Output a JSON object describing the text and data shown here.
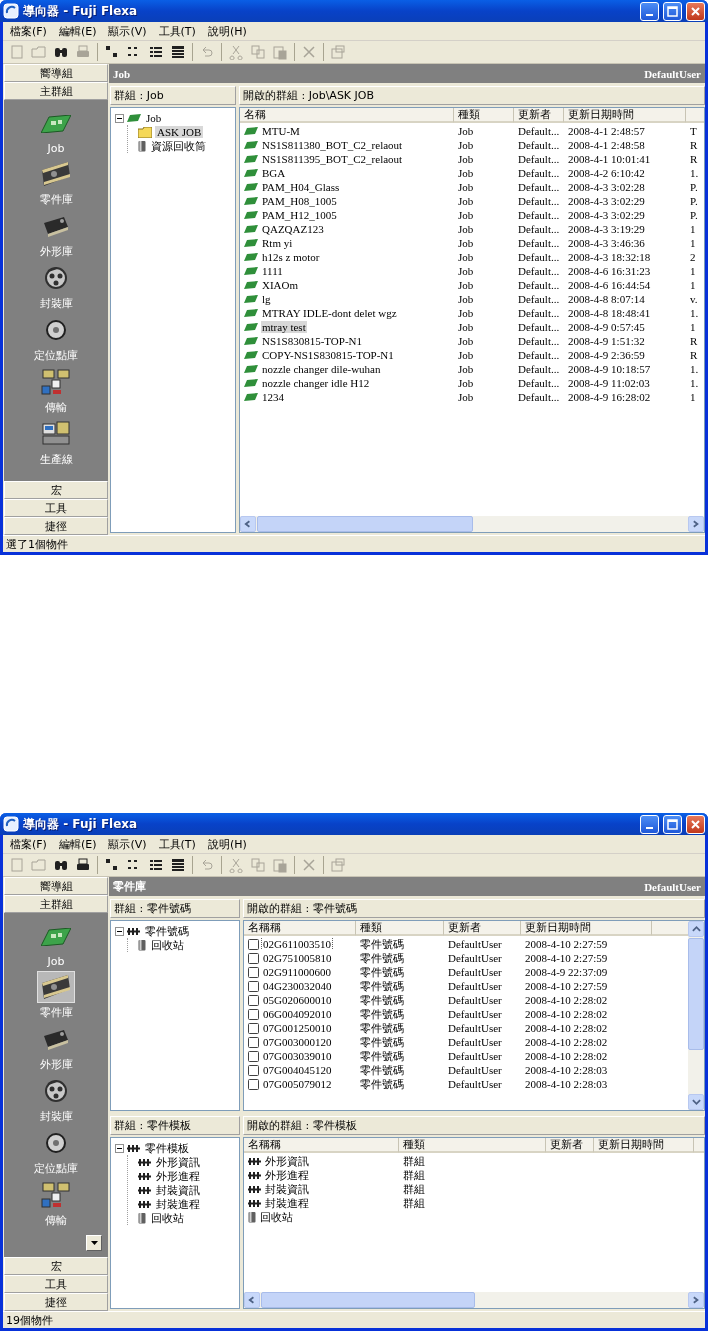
{
  "windows": [
    {
      "title": "導向器 - Fuji Flexa",
      "menu": [
        "檔案(F)",
        "編輯(E)",
        "顯示(V)",
        "工具(T)",
        "說明(H)"
      ],
      "toolbar": [
        {
          "kind": "new",
          "disabled": true
        },
        {
          "kind": "open",
          "disabled": true
        },
        {
          "kind": "find",
          "disabled": false
        },
        {
          "kind": "print",
          "disabled": true
        },
        {
          "kind": "separator"
        },
        {
          "kind": "large-icons",
          "disabled": false
        },
        {
          "kind": "small-icons",
          "disabled": false
        },
        {
          "kind": "list",
          "disabled": false
        },
        {
          "kind": "details",
          "disabled": false
        },
        {
          "kind": "separator"
        },
        {
          "kind": "undo",
          "disabled": true
        },
        {
          "kind": "separator"
        },
        {
          "kind": "cut",
          "disabled": true
        },
        {
          "kind": "copy",
          "disabled": true
        },
        {
          "kind": "paste",
          "disabled": true
        },
        {
          "kind": "separator"
        },
        {
          "kind": "delete",
          "disabled": true
        },
        {
          "kind": "separator"
        },
        {
          "kind": "properties",
          "disabled": true
        }
      ],
      "sidebar": {
        "top_tabs": [
          "嚮導組",
          "主群組"
        ],
        "items": [
          {
            "label": "Job",
            "kind": "job",
            "selected": false
          },
          {
            "label": "零件庫",
            "kind": "part",
            "selected": false
          },
          {
            "label": "外形庫",
            "kind": "shape",
            "selected": false
          },
          {
            "label": "封裝庫",
            "kind": "package",
            "selected": false
          },
          {
            "label": "定位點庫",
            "kind": "fiducial",
            "selected": false
          },
          {
            "label": "傳輸",
            "kind": "transfer",
            "selected": false
          },
          {
            "label": "生產線",
            "kind": "line",
            "selected": false
          }
        ],
        "bottom_tabs": [
          "宏",
          "工具",
          "捷徑"
        ]
      },
      "header": {
        "title": "Job",
        "user": "DefaultUser"
      },
      "panes": [
        {
          "tree": {
            "title": "群組 : Job",
            "nodes": [
              {
                "label": "Job",
                "kind": "job",
                "expanded": true,
                "selected": false,
                "children": [
                  {
                    "label": "ASK JOB",
                    "kind": "folder",
                    "selected": true
                  },
                  {
                    "label": "資源回收筒",
                    "kind": "recycle",
                    "selected": false
                  }
                ]
              }
            ]
          },
          "list": {
            "title": "開啟的群組 : Job\\ASK JOB",
            "columns": [
              "名稱",
              "種類",
              "更新者",
              "更新日期時間"
            ],
            "rows": [
              {
                "kind": "job",
                "selected": false,
                "cells": [
                  "MTU-M",
                  "Job",
                  "Default...",
                  "2008-4-1 2:48:57",
                  "T"
                ]
              },
              {
                "kind": "job",
                "selected": false,
                "cells": [
                  "NS1S811380_BOT_C2_relaout",
                  "Job",
                  "Default...",
                  "2008-4-1 2:48:58",
                  "R"
                ]
              },
              {
                "kind": "job",
                "selected": false,
                "cells": [
                  "NS1S811395_BOT_C2_relaout",
                  "Job",
                  "Default...",
                  "2008-4-1 10:01:41",
                  "R"
                ]
              },
              {
                "kind": "job",
                "selected": false,
                "cells": [
                  "BGA",
                  "Job",
                  "Default...",
                  "2008-4-2 6:10:42",
                  "1."
                ]
              },
              {
                "kind": "job",
                "selected": false,
                "cells": [
                  "PAM_H04_Glass",
                  "Job",
                  "Default...",
                  "2008-4-3 3:02:28",
                  "P."
                ]
              },
              {
                "kind": "job",
                "selected": false,
                "cells": [
                  "PAM_H08_1005",
                  "Job",
                  "Default...",
                  "2008-4-3 3:02:29",
                  "P."
                ]
              },
              {
                "kind": "job",
                "selected": false,
                "cells": [
                  "PAM_H12_1005",
                  "Job",
                  "Default...",
                  "2008-4-3 3:02:29",
                  "P."
                ]
              },
              {
                "kind": "job",
                "selected": false,
                "cells": [
                  "QAZQAZ123",
                  "Job",
                  "Default...",
                  "2008-4-3 3:19:29",
                  "1"
                ]
              },
              {
                "kind": "job",
                "selected": false,
                "cells": [
                  "Rtm yi",
                  "Job",
                  "Default...",
                  "2008-4-3 3:46:36",
                  "1"
                ]
              },
              {
                "kind": "job",
                "selected": false,
                "cells": [
                  "h12s z motor",
                  "Job",
                  "Default...",
                  "2008-4-3 18:32:18",
                  "2"
                ]
              },
              {
                "kind": "job",
                "selected": false,
                "cells": [
                  "1111",
                  "Job",
                  "Default...",
                  "2008-4-6 16:31:23",
                  "1"
                ]
              },
              {
                "kind": "job",
                "selected": false,
                "cells": [
                  "XIAOm",
                  "Job",
                  "Default...",
                  "2008-4-6 16:44:54",
                  "1"
                ]
              },
              {
                "kind": "job",
                "selected": false,
                "cells": [
                  "lg",
                  "Job",
                  "Default...",
                  "2008-4-8 8:07:14",
                  "v."
                ]
              },
              {
                "kind": "job",
                "selected": false,
                "cells": [
                  "MTRAY IDLE-dont delet  wgz",
                  "Job",
                  "Default...",
                  "2008-4-8 18:48:41",
                  "1."
                ]
              },
              {
                "kind": "job",
                "selected": true,
                "cells": [
                  "mtray test",
                  "Job",
                  "Default...",
                  "2008-4-9 0:57:45",
                  "1"
                ]
              },
              {
                "kind": "job",
                "selected": false,
                "cells": [
                  "NS1S830815-TOP-N1",
                  "Job",
                  "Default...",
                  "2008-4-9 1:51:32",
                  "R"
                ]
              },
              {
                "kind": "job",
                "selected": false,
                "cells": [
                  "COPY-NS1S830815-TOP-N1",
                  "Job",
                  "Default...",
                  "2008-4-9 2:36:59",
                  "R"
                ]
              },
              {
                "kind": "job",
                "selected": false,
                "cells": [
                  "nozzle changer dile-wuhan",
                  "Job",
                  "Default...",
                  "2008-4-9 10:18:57",
                  "1."
                ]
              },
              {
                "kind": "job",
                "selected": false,
                "cells": [
                  "nozzle changer idle H12",
                  "Job",
                  "Default...",
                  "2008-4-9 11:02:03",
                  "1."
                ]
              },
              {
                "kind": "job",
                "selected": false,
                "cells": [
                  "1234",
                  "Job",
                  "Default...",
                  "2008-4-9 16:28:02",
                  "1"
                ]
              }
            ]
          }
        }
      ],
      "status": "選了1個物件"
    },
    {
      "title": "導向器 - Fuji Flexa",
      "menu": [
        "檔案(F)",
        "編輯(E)",
        "顯示(V)",
        "工具(T)",
        "說明(H)"
      ],
      "toolbar": [
        {
          "kind": "new",
          "disabled": true
        },
        {
          "kind": "open",
          "disabled": true
        },
        {
          "kind": "find",
          "disabled": false
        },
        {
          "kind": "print",
          "disabled": false
        },
        {
          "kind": "separator"
        },
        {
          "kind": "large-icons",
          "disabled": false
        },
        {
          "kind": "small-icons",
          "disabled": false
        },
        {
          "kind": "list",
          "disabled": false
        },
        {
          "kind": "details",
          "disabled": false
        },
        {
          "kind": "separator"
        },
        {
          "kind": "undo",
          "disabled": true
        },
        {
          "kind": "separator"
        },
        {
          "kind": "cut",
          "disabled": true
        },
        {
          "kind": "copy",
          "disabled": true
        },
        {
          "kind": "paste",
          "disabled": true
        },
        {
          "kind": "separator"
        },
        {
          "kind": "delete",
          "disabled": true
        },
        {
          "kind": "separator"
        },
        {
          "kind": "properties",
          "disabled": true
        }
      ],
      "sidebar": {
        "top_tabs": [
          "嚮導組",
          "主群組"
        ],
        "items": [
          {
            "label": "Job",
            "kind": "job",
            "selected": false
          },
          {
            "label": "零件庫",
            "kind": "part",
            "selected": true
          },
          {
            "label": "外形庫",
            "kind": "shape",
            "selected": false
          },
          {
            "label": "封裝庫",
            "kind": "package",
            "selected": false
          },
          {
            "label": "定位點庫",
            "kind": "fiducial",
            "selected": false
          },
          {
            "label": "傳輸",
            "kind": "transfer",
            "selected": false
          }
        ],
        "more_button": true,
        "bottom_tabs": [
          "宏",
          "工具",
          "捷徑"
        ]
      },
      "header": {
        "title": "零件庫",
        "user": "DefaultUser"
      },
      "panes": [
        {
          "tree": {
            "title": "群組 : 零件號碼",
            "nodes": [
              {
                "label": "零件號碼",
                "kind": "group",
                "expanded": true,
                "selected": false,
                "children": [
                  {
                    "label": "回收站",
                    "kind": "recycle",
                    "selected": false
                  }
                ]
              }
            ]
          },
          "list": {
            "title": "開啟的群組 : 零件號碼",
            "columns": [
              "名稱稱",
              "種類",
              "更新者",
              "更新日期時間"
            ],
            "rows": [
              {
                "kind": "part",
                "focused": true,
                "cells": [
                  "02G611003510",
                  "零件號碼",
                  "DefaultUser",
                  "2008-4-10 2:27:59"
                ]
              },
              {
                "kind": "part",
                "focused": false,
                "cells": [
                  "02G751005810",
                  "零件號碼",
                  "DefaultUser",
                  "2008-4-10 2:27:59"
                ]
              },
              {
                "kind": "part",
                "focused": false,
                "cells": [
                  "02G911000600",
                  "零件號碼",
                  "DefaultUser",
                  "2008-4-9 22:37:09"
                ]
              },
              {
                "kind": "part",
                "focused": false,
                "cells": [
                  "04G230032040",
                  "零件號碼",
                  "DefaultUser",
                  "2008-4-10 2:27:59"
                ]
              },
              {
                "kind": "part",
                "focused": false,
                "cells": [
                  "05G020600010",
                  "零件號碼",
                  "DefaultUser",
                  "2008-4-10 2:28:02"
                ]
              },
              {
                "kind": "part",
                "focused": false,
                "cells": [
                  "06G004092010",
                  "零件號碼",
                  "DefaultUser",
                  "2008-4-10 2:28:02"
                ]
              },
              {
                "kind": "part",
                "focused": false,
                "cells": [
                  "07G001250010",
                  "零件號碼",
                  "DefaultUser",
                  "2008-4-10 2:28:02"
                ]
              },
              {
                "kind": "part",
                "focused": false,
                "cells": [
                  "07G003000120",
                  "零件號碼",
                  "DefaultUser",
                  "2008-4-10 2:28:02"
                ]
              },
              {
                "kind": "part",
                "focused": false,
                "cells": [
                  "07G003039010",
                  "零件號碼",
                  "DefaultUser",
                  "2008-4-10 2:28:02"
                ]
              },
              {
                "kind": "part",
                "focused": false,
                "cells": [
                  "07G004045120",
                  "零件號碼",
                  "DefaultUser",
                  "2008-4-10 2:28:03"
                ]
              },
              {
                "kind": "part",
                "focused": false,
                "cells": [
                  "07G005079012",
                  "零件號碼",
                  "DefaultUser",
                  "2008-4-10 2:28:03"
                ]
              }
            ]
          }
        },
        {
          "tree": {
            "title": "群組 : 零件模板",
            "nodes": [
              {
                "label": "零件模板",
                "kind": "group",
                "expanded": true,
                "selected": false,
                "children": [
                  {
                    "label": "外形資訊",
                    "kind": "group",
                    "selected": false
                  },
                  {
                    "label": "外形進程",
                    "kind": "group",
                    "selected": false
                  },
                  {
                    "label": "封裝資訊",
                    "kind": "group",
                    "selected": false
                  },
                  {
                    "label": "封裝進程",
                    "kind": "group",
                    "selected": false
                  },
                  {
                    "label": "回收站",
                    "kind": "recycle",
                    "selected": false
                  }
                ]
              }
            ]
          },
          "list": {
            "title": "開啟的群組 : 零件模板",
            "columns": [
              "名稱稱",
              "種類",
              "更新者",
              "更新日期時間"
            ],
            "rows": [
              {
                "kind": "group",
                "cells": [
                  "外形資訊",
                  "群組"
                ]
              },
              {
                "kind": "group",
                "cells": [
                  "外形進程",
                  "群組"
                ]
              },
              {
                "kind": "group",
                "cells": [
                  "封裝資訊",
                  "群組"
                ]
              },
              {
                "kind": "group",
                "cells": [
                  "封裝進程",
                  "群組"
                ]
              },
              {
                "kind": "recycle",
                "cells": [
                  "回收站"
                ]
              }
            ]
          }
        }
      ],
      "status": "19個物件"
    }
  ]
}
